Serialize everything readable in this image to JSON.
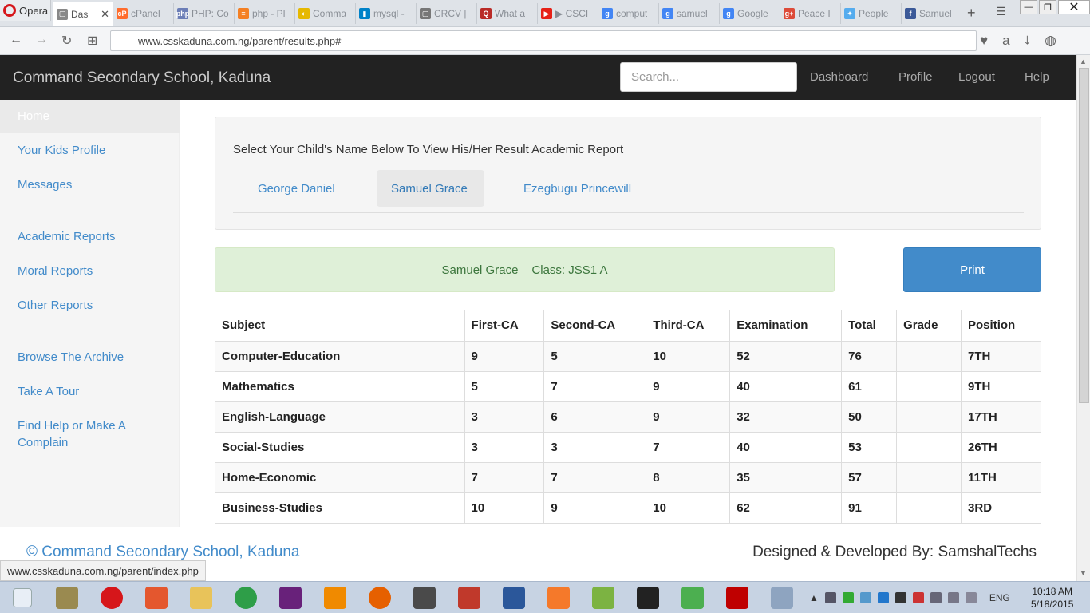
{
  "browser": {
    "app_name": "Opera",
    "tabs": [
      {
        "label": "Das",
        "fav_color": "#888888",
        "fav_glyph": "▢",
        "active": true
      },
      {
        "label": "cPanel",
        "fav_color": "#ff6c2c",
        "fav_glyph": "cP"
      },
      {
        "label": "PHP: Co",
        "fav_color": "#6c7eb7",
        "fav_glyph": "php"
      },
      {
        "label": "php - Pl",
        "fav_color": "#f48024",
        "fav_glyph": "≡"
      },
      {
        "label": "Comma",
        "fav_color": "#e6b800",
        "fav_glyph": "◐"
      },
      {
        "label": "mysql -",
        "fav_color": "#0082c8",
        "fav_glyph": "▮"
      },
      {
        "label": "CRCV |",
        "fav_color": "#777777",
        "fav_glyph": "▢"
      },
      {
        "label": "What a",
        "fav_color": "#b92b27",
        "fav_glyph": "Q"
      },
      {
        "label": "▶ CSCI",
        "fav_color": "#e62117",
        "fav_glyph": "▶"
      },
      {
        "label": "comput",
        "fav_color": "#4285f4",
        "fav_glyph": "g"
      },
      {
        "label": "samuel",
        "fav_color": "#4285f4",
        "fav_glyph": "g"
      },
      {
        "label": "Google",
        "fav_color": "#4285f4",
        "fav_glyph": "g"
      },
      {
        "label": "Peace I",
        "fav_color": "#dd4b39",
        "fav_glyph": "g+"
      },
      {
        "label": "People",
        "fav_color": "#55acee",
        "fav_glyph": "✦"
      },
      {
        "label": "Samuel",
        "fav_color": "#3b5998",
        "fav_glyph": "f"
      }
    ],
    "url": "www.csskaduna.com.ng/parent/results.php#",
    "status_url": "www.csskaduna.com.ng/parent/index.php"
  },
  "navbar": {
    "brand": "Command Secondary School, Kaduna",
    "search_placeholder": "Search...",
    "links": [
      "Dashboard",
      "Profile",
      "Logout",
      "Help"
    ]
  },
  "sidebar": {
    "home": "Home",
    "items": [
      "Your Kids Profile",
      "Messages",
      "Academic Reports",
      "Moral Reports",
      "Other Reports",
      "Browse The Archive",
      "Take A Tour",
      "Find Help or Make A Complain"
    ]
  },
  "selector": {
    "title": "Select Your Child's Name Below To View His/Her Result Academic Report",
    "children": [
      "George Daniel",
      "Samuel Grace",
      "Ezegbugu Princewill"
    ],
    "active_index": 1
  },
  "student": {
    "name": "Samuel Grace",
    "class_label": "Class: JSS1 A"
  },
  "print_label": "Print",
  "results": {
    "headers": [
      "Subject",
      "First-CA",
      "Second-CA",
      "Third-CA",
      "Examination",
      "Total",
      "Grade",
      "Position"
    ],
    "rows": [
      [
        "Computer-Education",
        "9",
        "5",
        "10",
        "52",
        "76",
        "",
        "7TH"
      ],
      [
        "Mathematics",
        "5",
        "7",
        "9",
        "40",
        "61",
        "",
        "9TH"
      ],
      [
        "English-Language",
        "3",
        "6",
        "9",
        "32",
        "50",
        "",
        "17TH"
      ],
      [
        "Social-Studies",
        "3",
        "3",
        "7",
        "40",
        "53",
        "",
        "26TH"
      ],
      [
        "Home-Economic",
        "7",
        "7",
        "8",
        "35",
        "57",
        "",
        "11TH"
      ],
      [
        "Business-Studies",
        "10",
        "9",
        "10",
        "62",
        "91",
        "",
        "3RD"
      ]
    ]
  },
  "footer": {
    "copyright": "© Command Secondary School, Kaduna",
    "credit": "Designed & Developed By: SamshalTechs"
  },
  "taskbar": {
    "icons": [
      {
        "name": "start-icon",
        "color": "#e8eef6"
      },
      {
        "name": "tools-icon",
        "color": "#9a8a50"
      },
      {
        "name": "opera-icon",
        "color": "#d6161a"
      },
      {
        "name": "apps-icon",
        "color": "#e4572e"
      },
      {
        "name": "explorer-icon",
        "color": "#e8c35a"
      },
      {
        "name": "chrome-icon",
        "color": "#2e9e48"
      },
      {
        "name": "visual-studio-icon",
        "color": "#68217a"
      },
      {
        "name": "vlc-icon",
        "color": "#f08a00"
      },
      {
        "name": "firefox-icon",
        "color": "#e66000"
      },
      {
        "name": "sublime-icon",
        "color": "#4a4a4a"
      },
      {
        "name": "snipping-icon",
        "color": "#c0392b"
      },
      {
        "name": "word-icon",
        "color": "#2b579a"
      },
      {
        "name": "blender-icon",
        "color": "#f5792a"
      },
      {
        "name": "office-icon",
        "color": "#7cb342"
      },
      {
        "name": "unity-icon",
        "color": "#222222"
      },
      {
        "name": "media-icon",
        "color": "#4caf50"
      },
      {
        "name": "filezilla-icon",
        "color": "#bf0000"
      },
      {
        "name": "monitor-icon",
        "color": "#8ea4c0"
      }
    ],
    "language": "ENG",
    "time": "10:18 AM",
    "date": "5/18/2015"
  }
}
